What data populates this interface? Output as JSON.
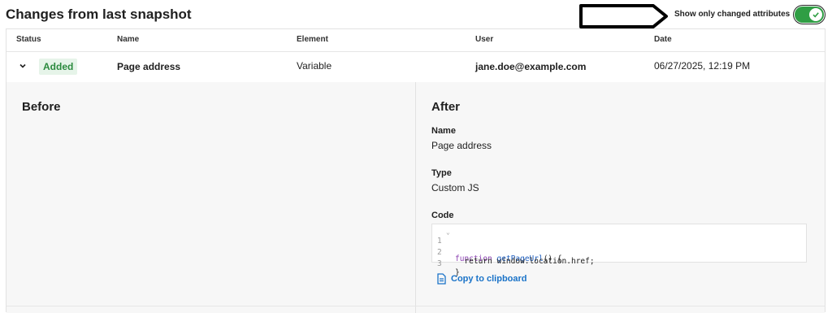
{
  "header": {
    "title": "Changes from last snapshot",
    "toggle_label": "Show only changed attributes",
    "toggle_on": true
  },
  "table": {
    "columns": [
      "Status",
      "Name",
      "Element",
      "User",
      "Date"
    ],
    "row": {
      "status": "Added",
      "name": "Page address",
      "element": "Variable",
      "user": "jane.doe@example.com",
      "date": "06/27/2025, 12:19 PM"
    }
  },
  "detail": {
    "before_title": "Before",
    "after_title": "After",
    "fields": {
      "name_label": "Name",
      "name_value": "Page address",
      "type_label": "Type",
      "type_value": "Custom JS",
      "code_label": "Code"
    },
    "code": {
      "lines": [
        {
          "num": "1",
          "kw": "function",
          "fn": "getPageUrl",
          "rest": "() {"
        },
        {
          "num": "2",
          "text": "  return window.location.href;"
        },
        {
          "num": "3",
          "text": "}"
        }
      ]
    },
    "copy_label": "Copy to clipboard"
  },
  "colors": {
    "added_badge_bg": "#e6f4e9",
    "added_badge_text": "#2b8a3e",
    "toggle_on": "#2f9e44",
    "link": "#1a73c8"
  }
}
